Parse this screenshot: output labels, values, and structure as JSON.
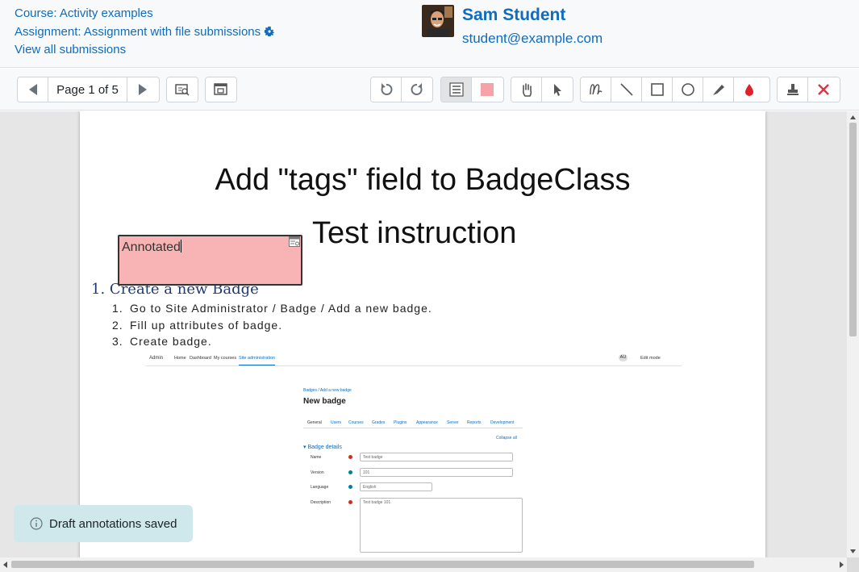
{
  "header": {
    "course_link": "Course: Activity examples",
    "assignment_link": "Assignment: Assignment with file submissions",
    "view_all_link": "View all submissions",
    "user_name": "Sam Student",
    "user_email": "student@example.com"
  },
  "toolbar": {
    "page_label": "Page 1 of 5",
    "buttons": [
      "prev-page",
      "next-page",
      "search-comments",
      "expand-collapse",
      "rotate-left",
      "rotate-right",
      "comment-color",
      "annotation-color",
      "pan",
      "select",
      "pen",
      "line",
      "rectangle",
      "oval",
      "highlight",
      "colour",
      "stamp",
      "delete"
    ]
  },
  "document": {
    "title": "Add \"tags\" field to BadgeClass",
    "subtitle": "Test instruction",
    "item_number": "1.",
    "item_text": "Create a new Badge",
    "steps": [
      {
        "n": "1.",
        "text": "Go to Site Administrator / Badge / Add a new badge."
      },
      {
        "n": "2.",
        "text": "Fill up attributes of badge."
      },
      {
        "n": "3.",
        "text": "Create badge."
      }
    ]
  },
  "annotation": {
    "text": "Annotated",
    "color": "#f8b4b4"
  },
  "embedded_screenshot": {
    "nav": [
      "Admin",
      "Home",
      "Dashboard",
      "My courses",
      "Site administration"
    ],
    "nav_right": [
      "AU",
      "Edit mode"
    ],
    "breadcrumb": "Badges / Add a new badge",
    "heading": "New badge",
    "tabs": [
      "General",
      "Users",
      "Courses",
      "Grades",
      "Plugins",
      "Appearance",
      "Server",
      "Reports",
      "Development"
    ],
    "collapse_all": "Collapse all",
    "section": "Badge details",
    "fields": [
      {
        "label": "Name",
        "value": "Test badge"
      },
      {
        "label": "Version",
        "value": "101"
      },
      {
        "label": "Language",
        "value": "English"
      },
      {
        "label": "Description",
        "value": "Test badge 101"
      }
    ]
  },
  "toast": {
    "message": "Draft annotations saved"
  },
  "colors": {
    "link": "#0f6cbf",
    "toast_bg": "#cfe8ec",
    "annotation_bg": "#f8b4b4",
    "delete_icon": "#dc3545",
    "colour_drop": "#e0212a"
  }
}
